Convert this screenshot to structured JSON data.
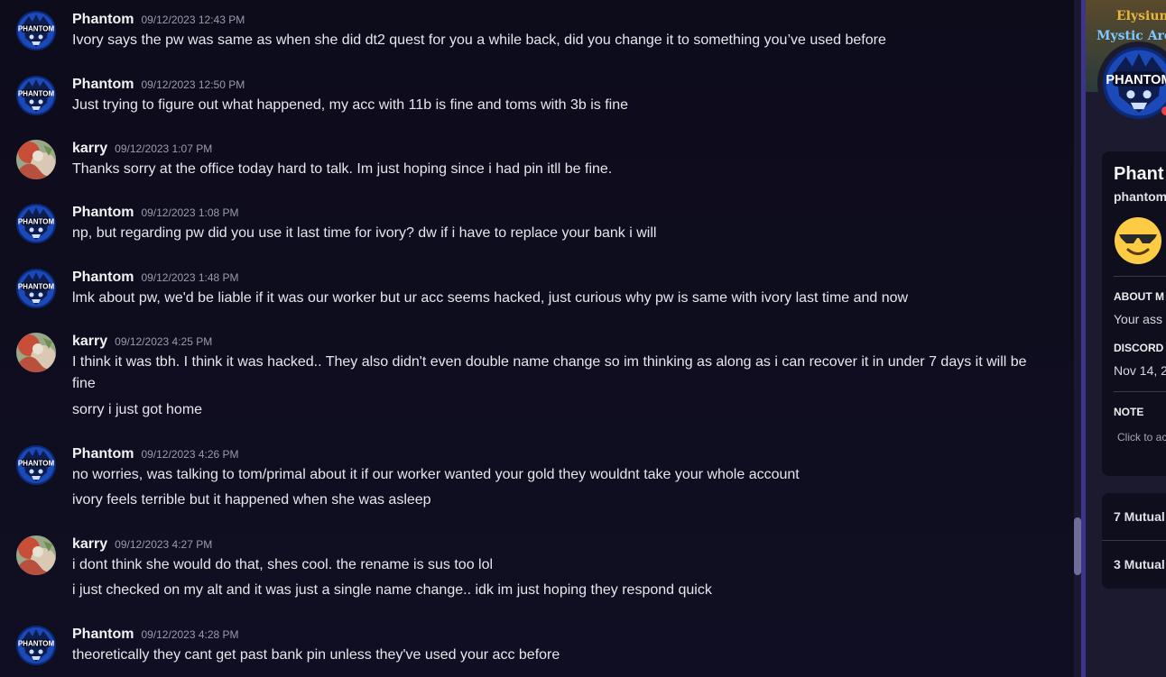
{
  "messages": [
    {
      "author": "Phantom",
      "avatar": "phantom",
      "time": "09/12/2023 12:43 PM",
      "lines": [
        "Ivory says the pw was same as when she did dt2 quest for you a while back, did you change it to something you’ve used before"
      ]
    },
    {
      "author": "Phantom",
      "avatar": "phantom",
      "time": "09/12/2023 12:50 PM",
      "lines": [
        "Just trying to figure out what happened, my acc with 11b is fine and toms with 3b is fine"
      ]
    },
    {
      "author": "karry",
      "avatar": "karry",
      "time": "09/12/2023 1:07 PM",
      "lines": [
        "Thanks sorry at the office today hard to talk. Im just hoping since i had pin itll be fine."
      ]
    },
    {
      "author": "Phantom",
      "avatar": "phantom",
      "time": "09/12/2023 1:08 PM",
      "lines": [
        "np, but regarding pw did you use it last time for ivory? dw if i have to replace your bank i will"
      ]
    },
    {
      "author": "Phantom",
      "avatar": "phantom",
      "time": "09/12/2023 1:48 PM",
      "lines": [
        "lmk about pw, we'd be liable if it was our worker but ur acc seems hacked, just curious why pw is same with ivory last time and now"
      ]
    },
    {
      "author": "karry",
      "avatar": "karry",
      "time": "09/12/2023 4:25 PM",
      "lines": [
        "I think it was tbh.  I think it was hacked.. They also didn't even double name change so im thinking as along as i can recover it in under 7 days it will be fine",
        "sorry i just got home"
      ]
    },
    {
      "author": "Phantom",
      "avatar": "phantom",
      "time": "09/12/2023 4:26 PM",
      "lines": [
        "no worries, was talking to tom/primal about it if our worker wanted your gold they wouldnt take your whole account",
        "ivory feels terrible but it happened when she was asleep"
      ]
    },
    {
      "author": "karry",
      "avatar": "karry",
      "time": "09/12/2023 4:27 PM",
      "lines": [
        "i dont think she would do that, shes cool. the rename is sus too lol",
        "i just checked on my alt and it was just a single name change.. idk im just hoping they respond quick"
      ]
    },
    {
      "author": "Phantom",
      "avatar": "phantom",
      "time": "09/12/2023 4:28 PM",
      "lines": [
        "theoretically they cant get past bank pin unless they've used your acc before"
      ]
    }
  ],
  "sidebar": {
    "banner_line1": "Elysium",
    "banner_line2": "Mystic Are",
    "display_name": "Phant",
    "username": "phantom",
    "about_heading": "ABOUT M",
    "about_text": "Your ass",
    "since_heading": "DISCORD",
    "since_value": "Nov 14, 2",
    "note_heading": "NOTE",
    "note_placeholder": "Click to ac",
    "mutual_servers": "7 Mutual",
    "mutual_friends": "3 Mutual"
  },
  "colors": {
    "accent": "#3b358c",
    "status_dnd": "#f23f43",
    "background": "#0e0d1c"
  },
  "icons": [
    "phantom-avatar",
    "karry-avatar",
    "sunglasses-emoji"
  ]
}
